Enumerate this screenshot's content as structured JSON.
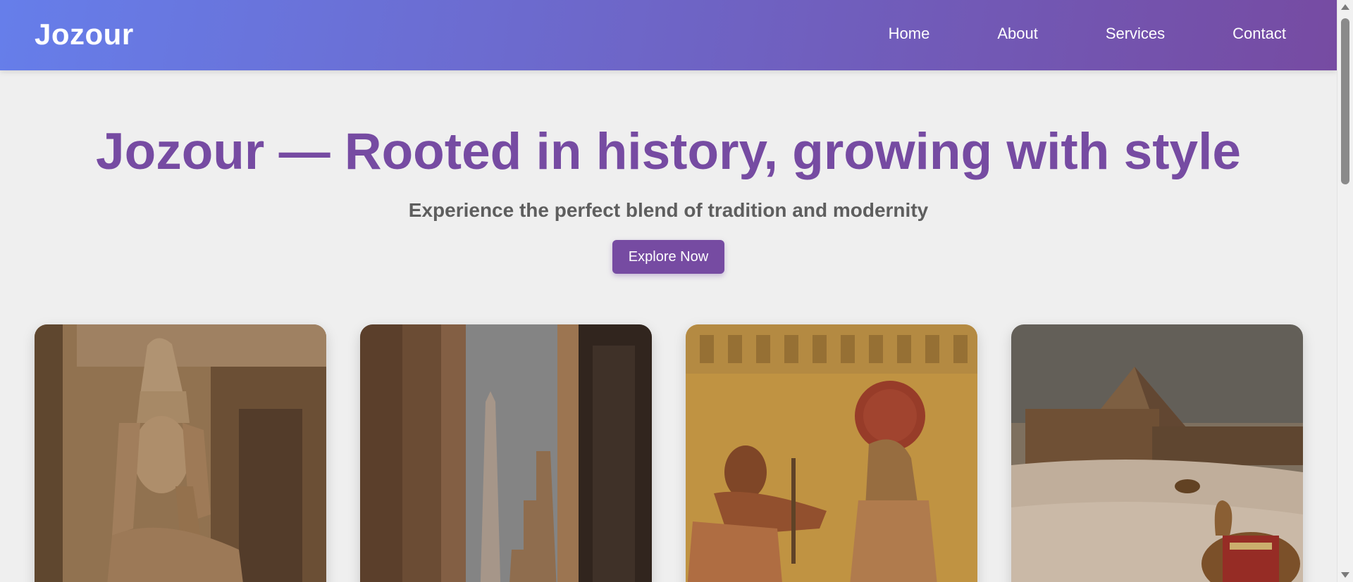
{
  "navbar": {
    "logo": "Jozour",
    "links": [
      "Home",
      "About",
      "Services",
      "Contact"
    ],
    "gradient_start": "#667eea",
    "gradient_end": "#764ba2"
  },
  "hero": {
    "title": "Jozour — Rooted in history, growing with style",
    "subtitle": "Experience the perfect blend of tradition and modernity",
    "cta_label": "Explore Now",
    "accent_color": "#764ba2"
  },
  "cards": [
    {
      "image": "pharaoh-statue"
    },
    {
      "image": "temple-columns-obelisk"
    },
    {
      "image": "egyptian-wall-relief"
    },
    {
      "image": "pyramid-with-camels"
    }
  ]
}
